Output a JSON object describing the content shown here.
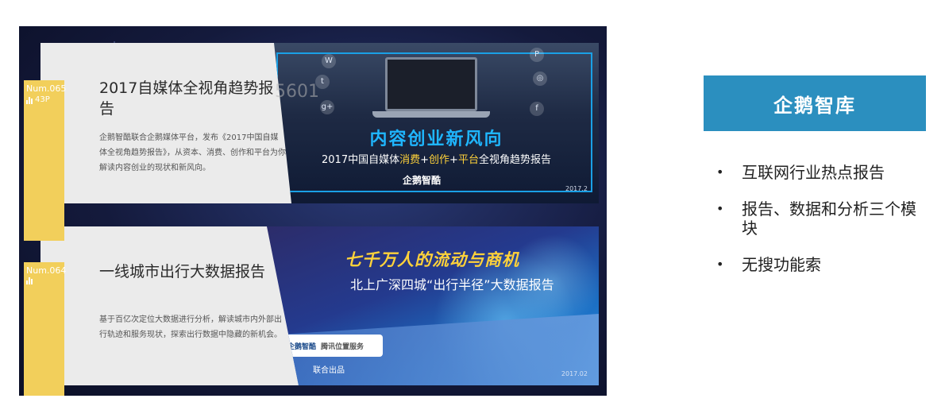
{
  "watermark": "5601",
  "cards": [
    {
      "num": "Num.065",
      "pages": "43P",
      "title": "2017自媒体全视角趋势报告",
      "desc": "企鹅智酷联合企鹅媒体平台，发布《2017中国自媒体全视角趋势报告》，从资本、消费、创作和平台为你解读内容创业的现状和新风向。",
      "banner": {
        "headline": "内容创业新风向",
        "sub_pre": "2017中国自媒体",
        "sub_hl1": "消费",
        "sub_mid1": "+",
        "sub_hl2": "创作",
        "sub_mid2": "+",
        "sub_hl3": "平台",
        "sub_post": "全视角趋势报告",
        "logo": "企鹅智酷",
        "date": "2017.2"
      }
    },
    {
      "num": "Num.064",
      "title": "一线城市出行大数据报告",
      "desc": "基于百亿次定位大数据进行分析，解读城市内外部出行轨迹和服务现状，探索出行数据中隐藏的新机会。",
      "banner": {
        "headline": "七千万人的流动与商机",
        "sub": "北上广深四城“出行半径”大数据报告",
        "logo1": "企鹅智酷",
        "logo2": "腾讯位置服务",
        "joint": "联合出品",
        "date": "2017.02"
      }
    }
  ],
  "brand": "企鹅智库",
  "bullets": [
    "互联网行业热点报告",
    "报告、数据和分析三个模块",
    "无搜功能索"
  ]
}
